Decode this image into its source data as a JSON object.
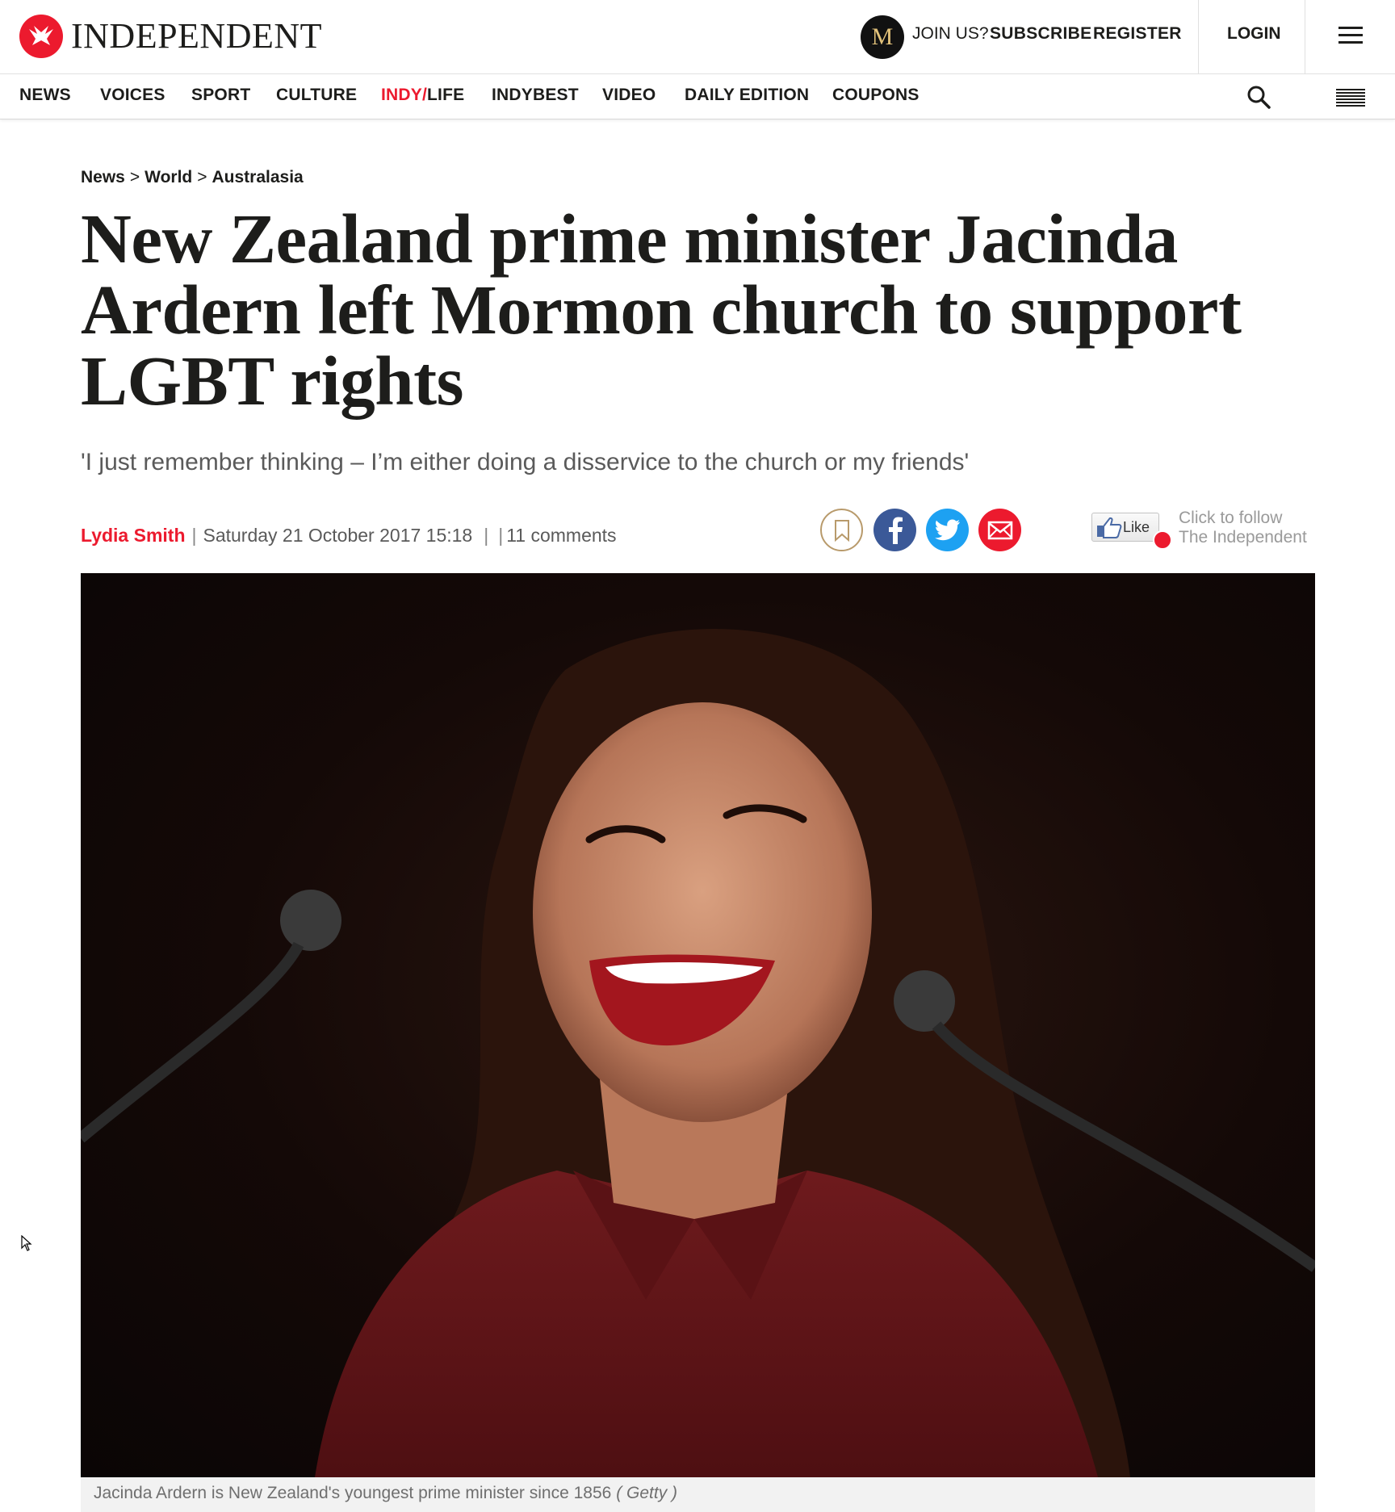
{
  "header": {
    "brand": "INDEPENDENT",
    "membership_badge": "M",
    "join_us": "JOIN US?",
    "subscribe": "SUBSCRIBE",
    "register": "REGISTER",
    "login": "LOGIN"
  },
  "nav": {
    "items": [
      "NEWS",
      "VOICES",
      "SPORT",
      "CULTURE",
      "INDY/",
      "LIFE",
      "INDYBEST",
      "VIDEO",
      "DAILY EDITION",
      "COUPONS"
    ]
  },
  "breadcrumb": {
    "items": [
      "News",
      "World",
      "Australasia"
    ],
    "separator": ">"
  },
  "article": {
    "headline": "New Zealand prime minister Jacinda Ardern left Mormon church to support LGBT rights",
    "standfirst": "'I just remember thinking – I’m either doing a disservice to the church or my friends'",
    "author": "Lydia Smith",
    "date": "Saturday 21 October 2017 15:18",
    "comments": "11 comments",
    "pipe": "|"
  },
  "social": {
    "like_label": "Like",
    "follow_line1": "Click to follow",
    "follow_line2": "The Independent"
  },
  "image": {
    "caption": "Jacinda Ardern is New Zealand's youngest prime minister since 1856",
    "credit": "( Getty )"
  },
  "colors": {
    "brand_red": "#ec1a2e",
    "facebook": "#3b5998",
    "twitter": "#1da1f2",
    "bookmark_gold": "#b89a6b"
  }
}
